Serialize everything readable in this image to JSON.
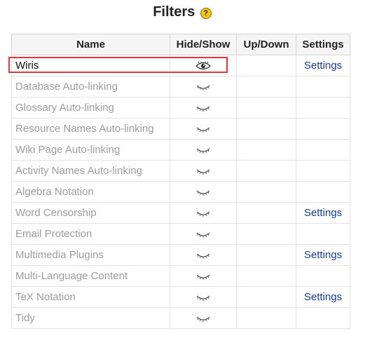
{
  "page": {
    "title": "Filters",
    "help_icon": "question-mark-icon",
    "help_glyph": "?"
  },
  "table": {
    "headers": {
      "name": "Name",
      "hide_show": "Hide/Show",
      "up_down": "Up/Down",
      "settings": "Settings"
    },
    "rows": [
      {
        "name": "Wiris",
        "enabled": true,
        "icon": "eye-open-icon",
        "settings": "Settings"
      },
      {
        "name": "Database Auto-linking",
        "enabled": false,
        "icon": "eye-closed-icon",
        "settings": ""
      },
      {
        "name": "Glossary Auto-linking",
        "enabled": false,
        "icon": "eye-closed-icon",
        "settings": ""
      },
      {
        "name": "Resource Names Auto-linking",
        "enabled": false,
        "icon": "eye-closed-icon",
        "settings": ""
      },
      {
        "name": "Wiki Page Auto-linking",
        "enabled": false,
        "icon": "eye-closed-icon",
        "settings": ""
      },
      {
        "name": "Activity Names Auto-linking",
        "enabled": false,
        "icon": "eye-closed-icon",
        "settings": ""
      },
      {
        "name": "Algebra Notation",
        "enabled": false,
        "icon": "eye-closed-icon",
        "settings": ""
      },
      {
        "name": "Word Censorship",
        "enabled": false,
        "icon": "eye-closed-icon",
        "settings": "Settings"
      },
      {
        "name": "Email Protection",
        "enabled": false,
        "icon": "eye-closed-icon",
        "settings": ""
      },
      {
        "name": "Multimedia Plugins",
        "enabled": false,
        "icon": "eye-closed-icon",
        "settings": "Settings"
      },
      {
        "name": "Multi-Language Content",
        "enabled": false,
        "icon": "eye-closed-icon",
        "settings": ""
      },
      {
        "name": "TeX Notation",
        "enabled": false,
        "icon": "eye-closed-icon",
        "settings": "Settings"
      },
      {
        "name": "Tidy",
        "enabled": false,
        "icon": "eye-closed-icon",
        "settings": ""
      }
    ]
  },
  "colors": {
    "highlight_border": "#e0353b",
    "link": "#1a3c8c",
    "disabled_text": "#9c9c9c",
    "enabled_text": "#111111"
  }
}
